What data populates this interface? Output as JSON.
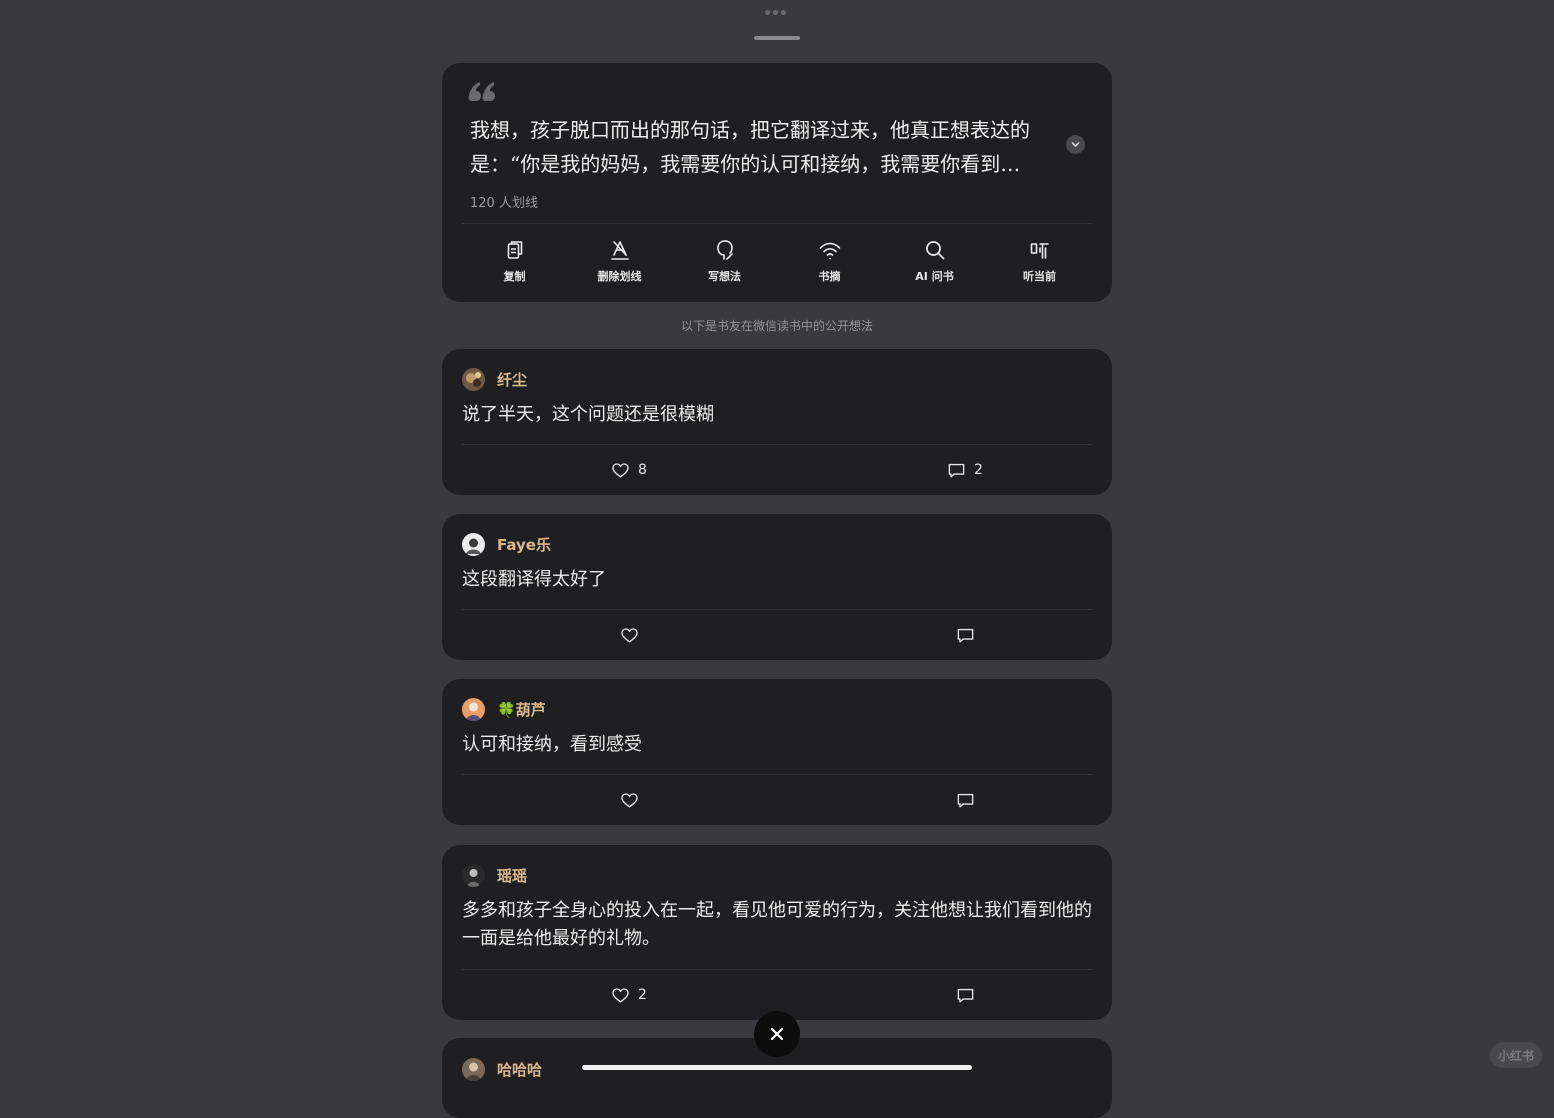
{
  "highlight": {
    "text": "我想，孩子脱口而出的那句话，把它翻译过来，他真正想表达的是：“你是我的妈妈，我需要你的认可和接纳，我需要你看到…",
    "count": "120 人划线"
  },
  "actions": [
    {
      "label": "复制",
      "icon": "copy-icon"
    },
    {
      "label": "删除划线",
      "icon": "erase-highlight-icon"
    },
    {
      "label": "写想法",
      "icon": "write-thought-icon"
    },
    {
      "label": "书摘",
      "icon": "excerpt-icon"
    },
    {
      "label": "AI 问书",
      "icon": "search-icon"
    },
    {
      "label": "听当前",
      "icon": "listen-icon"
    }
  ],
  "info": "以下是书友在微信读书中的公开想法",
  "comments": [
    {
      "user": "纤尘",
      "text": "说了半天，这个问题还是很模糊",
      "likes": "8",
      "replies": "2"
    },
    {
      "user": "Faye乐",
      "text": "这段翻译得太好了",
      "likes": "",
      "replies": ""
    },
    {
      "user": "🍀葫芦",
      "text": "认可和接纳，看到感受",
      "likes": "",
      "replies": ""
    },
    {
      "user": "瑶瑶",
      "text": "多多和孩子全身心的投入在一起，看见他可爱的行为，关注他想让我们看到他的一面是给他最好的礼物。",
      "likes": "2",
      "replies": ""
    },
    {
      "user": "哈哈哈"
    }
  ],
  "watermark": "小红书",
  "colors": {
    "background": "#3a393e",
    "card": "#1f1f21",
    "username": "#d9b88c",
    "text": "#ececec"
  }
}
